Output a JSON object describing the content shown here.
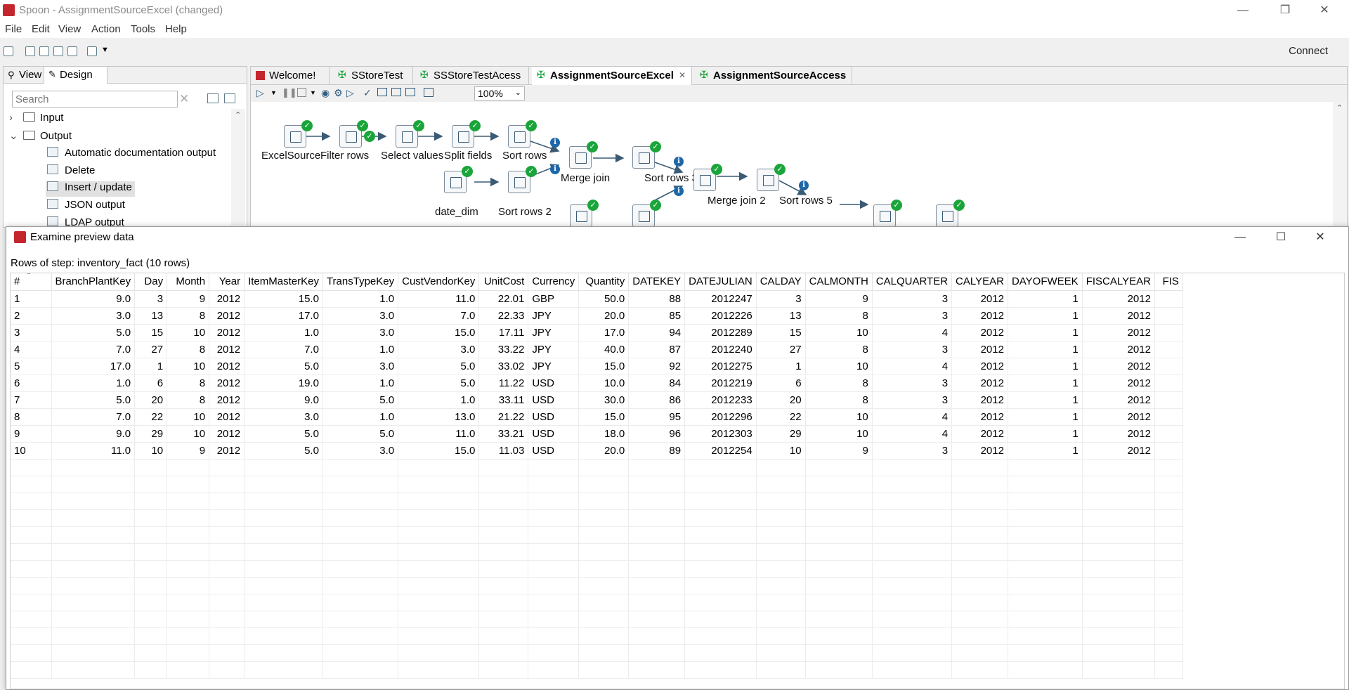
{
  "window": {
    "title": "Spoon - AssignmentSourceExcel (changed)"
  },
  "menu": [
    "File",
    "Edit",
    "View",
    "Action",
    "Tools",
    "Help"
  ],
  "toolbar": {
    "connect_label": "Connect"
  },
  "left_panel": {
    "tabs": [
      "View",
      "Design"
    ],
    "search_placeholder": "Search",
    "tree": [
      {
        "label": "Input",
        "type": "folder",
        "expanded": false
      },
      {
        "label": "Output",
        "type": "folder",
        "expanded": true
      },
      {
        "label": "Automatic documentation output",
        "type": "leaf"
      },
      {
        "label": "Delete",
        "type": "leaf"
      },
      {
        "label": "Insert / update",
        "type": "leaf",
        "selected": true
      },
      {
        "label": "JSON output",
        "type": "leaf"
      },
      {
        "label": "LDAP output",
        "type": "leaf"
      }
    ]
  },
  "editor": {
    "tabs": [
      {
        "label": "Welcome!",
        "active": false
      },
      {
        "label": "SStoreTest",
        "active": false
      },
      {
        "label": "SSStoreTestAcess",
        "active": false
      },
      {
        "label": "AssignmentSourceExcel",
        "active": true
      },
      {
        "label": "AssignmentSourceAccess",
        "active": false
      }
    ],
    "zoom": "100%",
    "steps": [
      "ExcelSource",
      "Filter rows",
      "Select values",
      "Split fields",
      "Sort rows",
      "Merge join",
      "Sort rows 3",
      "Merge join 2",
      "Sort rows 5",
      "date_dim",
      "Sort rows 2"
    ]
  },
  "dialog": {
    "title": "Examine preview data",
    "rows_label": "Rows of step: inventory_fact (10 rows)",
    "columns": [
      "#",
      "BranchPlantKey",
      "Day",
      "Month",
      "Year",
      "ItemMasterKey",
      "TransTypeKey",
      "CustVendorKey",
      "UnitCost",
      "Currency",
      "Quantity",
      "DATEKEY",
      "DATEJULIAN",
      "CALDAY",
      "CALMONTH",
      "CALQUARTER",
      "CALYEAR",
      "DAYOFWEEK",
      "FISCALYEAR",
      "FIS"
    ],
    "rows": [
      [
        "1",
        "9.0",
        "3",
        "9",
        "2012",
        "15.0",
        "1.0",
        "11.0",
        "22.01",
        "GBP",
        "50.0",
        "88",
        "2012247",
        "3",
        "9",
        "3",
        "2012",
        "1",
        "2012",
        ""
      ],
      [
        "2",
        "3.0",
        "13",
        "8",
        "2012",
        "17.0",
        "3.0",
        "7.0",
        "22.33",
        "JPY",
        "20.0",
        "85",
        "2012226",
        "13",
        "8",
        "3",
        "2012",
        "1",
        "2012",
        ""
      ],
      [
        "3",
        "5.0",
        "15",
        "10",
        "2012",
        "1.0",
        "3.0",
        "15.0",
        "17.11",
        "JPY",
        "17.0",
        "94",
        "2012289",
        "15",
        "10",
        "4",
        "2012",
        "1",
        "2012",
        ""
      ],
      [
        "4",
        "7.0",
        "27",
        "8",
        "2012",
        "7.0",
        "1.0",
        "3.0",
        "33.22",
        "JPY",
        "40.0",
        "87",
        "2012240",
        "27",
        "8",
        "3",
        "2012",
        "1",
        "2012",
        ""
      ],
      [
        "5",
        "17.0",
        "1",
        "10",
        "2012",
        "5.0",
        "3.0",
        "5.0",
        "33.02",
        "JPY",
        "15.0",
        "92",
        "2012275",
        "1",
        "10",
        "4",
        "2012",
        "1",
        "2012",
        ""
      ],
      [
        "6",
        "1.0",
        "6",
        "8",
        "2012",
        "19.0",
        "1.0",
        "5.0",
        "11.22",
        "USD",
        "10.0",
        "84",
        "2012219",
        "6",
        "8",
        "3",
        "2012",
        "1",
        "2012",
        ""
      ],
      [
        "7",
        "5.0",
        "20",
        "8",
        "2012",
        "9.0",
        "5.0",
        "1.0",
        "33.11",
        "USD",
        "30.0",
        "86",
        "2012233",
        "20",
        "8",
        "3",
        "2012",
        "1",
        "2012",
        ""
      ],
      [
        "8",
        "7.0",
        "22",
        "10",
        "2012",
        "3.0",
        "1.0",
        "13.0",
        "21.22",
        "USD",
        "15.0",
        "95",
        "2012296",
        "22",
        "10",
        "4",
        "2012",
        "1",
        "2012",
        ""
      ],
      [
        "9",
        "9.0",
        "29",
        "10",
        "2012",
        "5.0",
        "5.0",
        "11.0",
        "33.21",
        "USD",
        "18.0",
        "96",
        "2012303",
        "29",
        "10",
        "4",
        "2012",
        "1",
        "2012",
        ""
      ],
      [
        "10",
        "11.0",
        "10",
        "9",
        "2012",
        "5.0",
        "3.0",
        "15.0",
        "11.03",
        "USD",
        "20.0",
        "89",
        "2012254",
        "10",
        "9",
        "3",
        "2012",
        "1",
        "2012",
        ""
      ]
    ]
  },
  "colors": {
    "accent": "#c4262e",
    "ok": "#1aa53a",
    "info": "#1d67a8"
  }
}
